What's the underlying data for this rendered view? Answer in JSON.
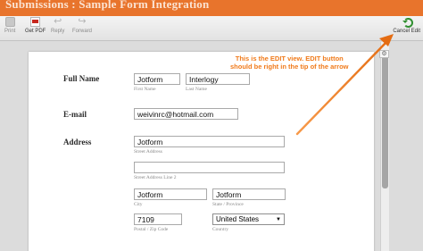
{
  "window": {
    "title": "Submissions : Sample Form Integration"
  },
  "toolbar": {
    "print": "Print",
    "get_pdf": "Get PDF",
    "reply": "Reply",
    "forward": "Forward",
    "cancel_edit": "Cancel Edit"
  },
  "annotation": {
    "line1": "This is the EDIT view. EDIT button",
    "line2": "should be right in the tip of the arrow"
  },
  "form": {
    "full_name_label": "Full Name",
    "first_name": "Jotform",
    "first_name_sub": "First Name",
    "last_name": "Interlogy",
    "last_name_sub": "Last Name",
    "email_label": "E-mail",
    "email": "weivinrc@hotmail.com",
    "address_label": "Address",
    "street": "Jotform",
    "street_sub": "Street Address",
    "street2": "",
    "street2_sub": "Street Address Line 2",
    "city": "Jotform",
    "city_sub": "City",
    "state": "Jotform",
    "state_sub": "State / Province",
    "zip": "7109",
    "zip_sub": "Postal / Zip Code",
    "country": "United States",
    "country_sub": "Country"
  },
  "colors": {
    "title_bar": "#e8742c",
    "annotation": "#f07a1a"
  }
}
